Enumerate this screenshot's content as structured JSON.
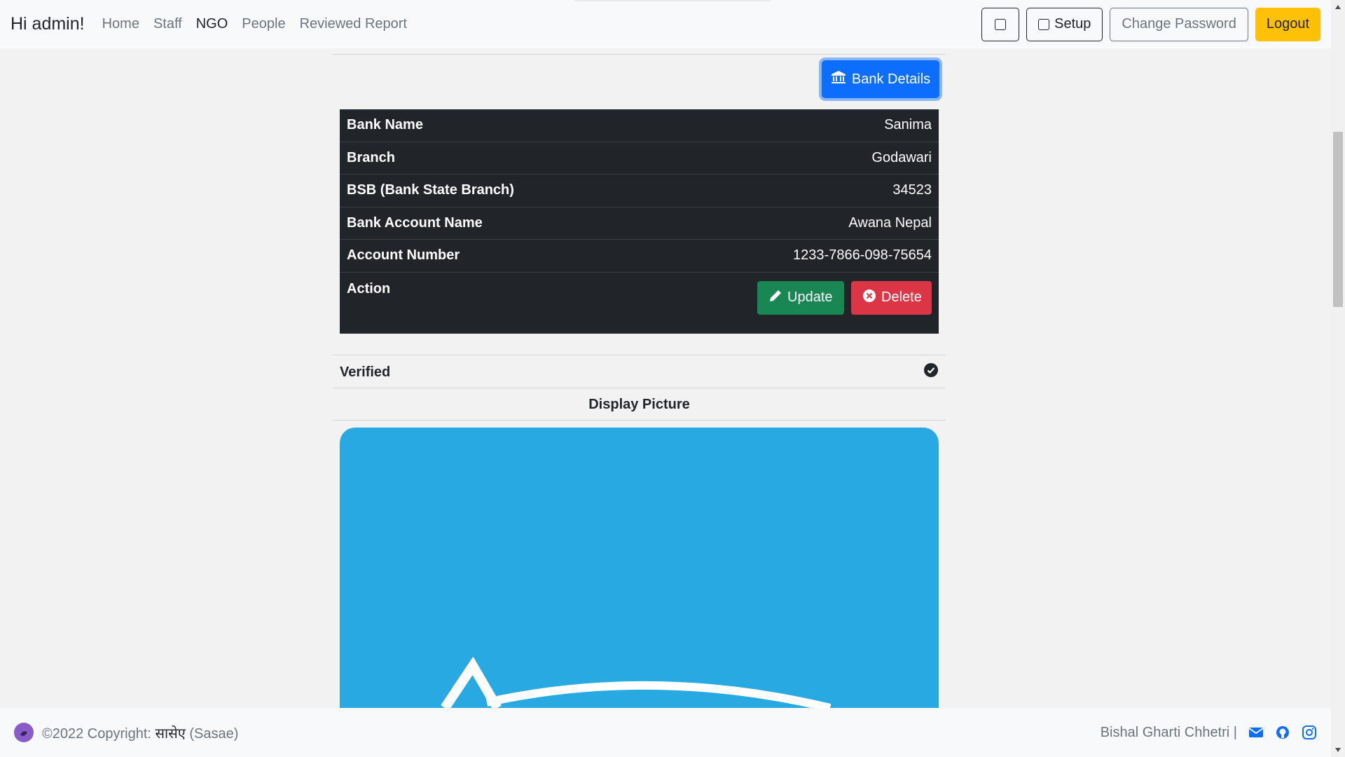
{
  "navbar": {
    "greeting": "Hi admin!",
    "links": [
      "Home",
      "Staff",
      "NGO",
      "People",
      "Reviewed Report"
    ],
    "active_link": "NGO",
    "setup_label": "Setup",
    "change_password_label": "Change Password",
    "logout_label": "Logout"
  },
  "bank": {
    "button_label": "Bank Details",
    "rows": [
      {
        "label": "Bank Name",
        "value": "Sanima"
      },
      {
        "label": "Branch",
        "value": "Godawari"
      },
      {
        "label": "BSB (Bank State Branch)",
        "value": "34523"
      },
      {
        "label": "Bank Account Name",
        "value": "Awana Nepal"
      },
      {
        "label": "Account Number",
        "value": "1233-7866-098-75654"
      }
    ],
    "action_label": "Action",
    "update_label": "Update",
    "delete_label": "Delete"
  },
  "verified_label": "Verified",
  "display_picture_label": "Display Picture",
  "footer": {
    "copyright": "©2022 Copyright:",
    "brand": "सासेए",
    "brand_latin": "(Sasae)",
    "author": "Bishal Gharti Chhetri |"
  },
  "colors": {
    "primary": "#0d6efd",
    "success": "#198754",
    "danger": "#dc3545",
    "warning": "#ffc107",
    "dark": "#212529",
    "picture_bg": "#29a9e1"
  }
}
